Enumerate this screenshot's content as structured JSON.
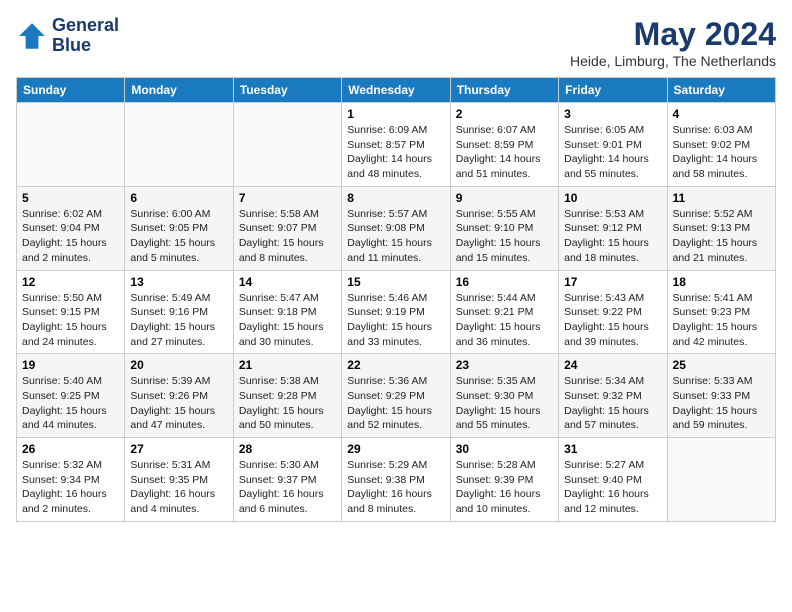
{
  "header": {
    "logo_line1": "General",
    "logo_line2": "Blue",
    "month_year": "May 2024",
    "location": "Heide, Limburg, The Netherlands"
  },
  "weekdays": [
    "Sunday",
    "Monday",
    "Tuesday",
    "Wednesday",
    "Thursday",
    "Friday",
    "Saturday"
  ],
  "weeks": [
    [
      {
        "day": "",
        "info": ""
      },
      {
        "day": "",
        "info": ""
      },
      {
        "day": "",
        "info": ""
      },
      {
        "day": "1",
        "info": "Sunrise: 6:09 AM\nSunset: 8:57 PM\nDaylight: 14 hours\nand 48 minutes."
      },
      {
        "day": "2",
        "info": "Sunrise: 6:07 AM\nSunset: 8:59 PM\nDaylight: 14 hours\nand 51 minutes."
      },
      {
        "day": "3",
        "info": "Sunrise: 6:05 AM\nSunset: 9:01 PM\nDaylight: 14 hours\nand 55 minutes."
      },
      {
        "day": "4",
        "info": "Sunrise: 6:03 AM\nSunset: 9:02 PM\nDaylight: 14 hours\nand 58 minutes."
      }
    ],
    [
      {
        "day": "5",
        "info": "Sunrise: 6:02 AM\nSunset: 9:04 PM\nDaylight: 15 hours\nand 2 minutes."
      },
      {
        "day": "6",
        "info": "Sunrise: 6:00 AM\nSunset: 9:05 PM\nDaylight: 15 hours\nand 5 minutes."
      },
      {
        "day": "7",
        "info": "Sunrise: 5:58 AM\nSunset: 9:07 PM\nDaylight: 15 hours\nand 8 minutes."
      },
      {
        "day": "8",
        "info": "Sunrise: 5:57 AM\nSunset: 9:08 PM\nDaylight: 15 hours\nand 11 minutes."
      },
      {
        "day": "9",
        "info": "Sunrise: 5:55 AM\nSunset: 9:10 PM\nDaylight: 15 hours\nand 15 minutes."
      },
      {
        "day": "10",
        "info": "Sunrise: 5:53 AM\nSunset: 9:12 PM\nDaylight: 15 hours\nand 18 minutes."
      },
      {
        "day": "11",
        "info": "Sunrise: 5:52 AM\nSunset: 9:13 PM\nDaylight: 15 hours\nand 21 minutes."
      }
    ],
    [
      {
        "day": "12",
        "info": "Sunrise: 5:50 AM\nSunset: 9:15 PM\nDaylight: 15 hours\nand 24 minutes."
      },
      {
        "day": "13",
        "info": "Sunrise: 5:49 AM\nSunset: 9:16 PM\nDaylight: 15 hours\nand 27 minutes."
      },
      {
        "day": "14",
        "info": "Sunrise: 5:47 AM\nSunset: 9:18 PM\nDaylight: 15 hours\nand 30 minutes."
      },
      {
        "day": "15",
        "info": "Sunrise: 5:46 AM\nSunset: 9:19 PM\nDaylight: 15 hours\nand 33 minutes."
      },
      {
        "day": "16",
        "info": "Sunrise: 5:44 AM\nSunset: 9:21 PM\nDaylight: 15 hours\nand 36 minutes."
      },
      {
        "day": "17",
        "info": "Sunrise: 5:43 AM\nSunset: 9:22 PM\nDaylight: 15 hours\nand 39 minutes."
      },
      {
        "day": "18",
        "info": "Sunrise: 5:41 AM\nSunset: 9:23 PM\nDaylight: 15 hours\nand 42 minutes."
      }
    ],
    [
      {
        "day": "19",
        "info": "Sunrise: 5:40 AM\nSunset: 9:25 PM\nDaylight: 15 hours\nand 44 minutes."
      },
      {
        "day": "20",
        "info": "Sunrise: 5:39 AM\nSunset: 9:26 PM\nDaylight: 15 hours\nand 47 minutes."
      },
      {
        "day": "21",
        "info": "Sunrise: 5:38 AM\nSunset: 9:28 PM\nDaylight: 15 hours\nand 50 minutes."
      },
      {
        "day": "22",
        "info": "Sunrise: 5:36 AM\nSunset: 9:29 PM\nDaylight: 15 hours\nand 52 minutes."
      },
      {
        "day": "23",
        "info": "Sunrise: 5:35 AM\nSunset: 9:30 PM\nDaylight: 15 hours\nand 55 minutes."
      },
      {
        "day": "24",
        "info": "Sunrise: 5:34 AM\nSunset: 9:32 PM\nDaylight: 15 hours\nand 57 minutes."
      },
      {
        "day": "25",
        "info": "Sunrise: 5:33 AM\nSunset: 9:33 PM\nDaylight: 15 hours\nand 59 minutes."
      }
    ],
    [
      {
        "day": "26",
        "info": "Sunrise: 5:32 AM\nSunset: 9:34 PM\nDaylight: 16 hours\nand 2 minutes."
      },
      {
        "day": "27",
        "info": "Sunrise: 5:31 AM\nSunset: 9:35 PM\nDaylight: 16 hours\nand 4 minutes."
      },
      {
        "day": "28",
        "info": "Sunrise: 5:30 AM\nSunset: 9:37 PM\nDaylight: 16 hours\nand 6 minutes."
      },
      {
        "day": "29",
        "info": "Sunrise: 5:29 AM\nSunset: 9:38 PM\nDaylight: 16 hours\nand 8 minutes."
      },
      {
        "day": "30",
        "info": "Sunrise: 5:28 AM\nSunset: 9:39 PM\nDaylight: 16 hours\nand 10 minutes."
      },
      {
        "day": "31",
        "info": "Sunrise: 5:27 AM\nSunset: 9:40 PM\nDaylight: 16 hours\nand 12 minutes."
      },
      {
        "day": "",
        "info": ""
      }
    ]
  ]
}
